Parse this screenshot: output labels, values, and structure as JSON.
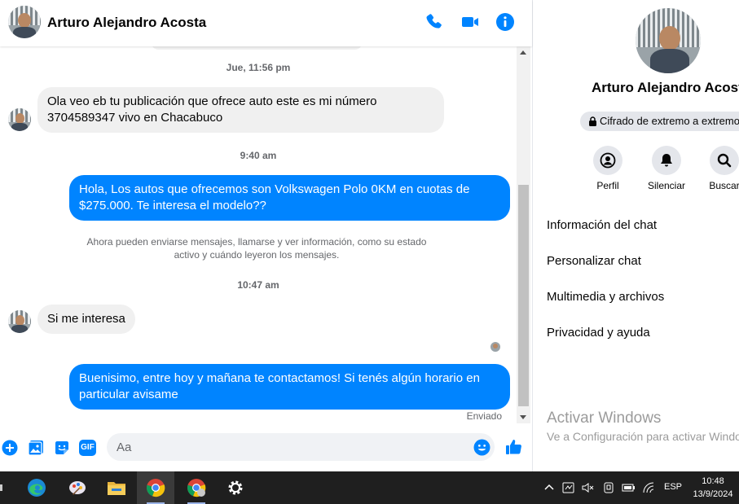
{
  "header": {
    "contact_name": "Arturo Alejandro Acosta",
    "icons": [
      "phone-icon",
      "video-camera-icon",
      "info-icon"
    ],
    "accent_color": "#0084ff"
  },
  "messages": {
    "timestamp_1": "Jue, 11:56 pm",
    "msg_1": "Ola veo eb tu publicación que ofrece auto este es mi número 3704589347 vivo en Chacabuco",
    "timestamp_2": "9:40 am",
    "msg_2": "Hola, Los autos que ofrecemos son Volkswagen Polo 0KM en cuotas de $275.000. Te interesa el modelo??",
    "system_notice": "Ahora pueden enviarse mensajes, llamarse y ver información, como su estado activo y cuándo leyeron los mensajes.",
    "timestamp_3": "10:47 am",
    "msg_3": "Si me interesa",
    "msg_4": "Buenisimo, entre hoy y mañana te contactamos! Si tenés algún horario en particular avisame",
    "status": "Enviado"
  },
  "composer": {
    "placeholder": "Aa",
    "icons": [
      "plus-icon",
      "image-icon",
      "sticker-icon",
      "gif-icon",
      "emoji-icon",
      "like-icon"
    ],
    "gif_label": "GIF"
  },
  "panel": {
    "name": "Arturo Alejandro Acosta",
    "encryption": "Cifrado de extremo a extremo",
    "actions": [
      {
        "label": "Perfil",
        "icon": "profile-icon"
      },
      {
        "label": "Silenciar",
        "icon": "bell-icon"
      },
      {
        "label": "Buscar",
        "icon": "search-icon"
      }
    ],
    "menu": [
      "Información del chat",
      "Personalizar chat",
      "Multimedia y archivos",
      "Privacidad y ayuda"
    ]
  },
  "watermark": {
    "title": "Activar Windows",
    "subtitle": "Ve a Configuración para activar Windows."
  },
  "taskbar": {
    "apps": [
      "edge-icon",
      "paint-icon",
      "file-explorer-icon",
      "chrome-icon",
      "chrome-profile-icon",
      "settings-icon"
    ],
    "language": "ESP",
    "time": "10:48",
    "date": "13/9/2024"
  }
}
